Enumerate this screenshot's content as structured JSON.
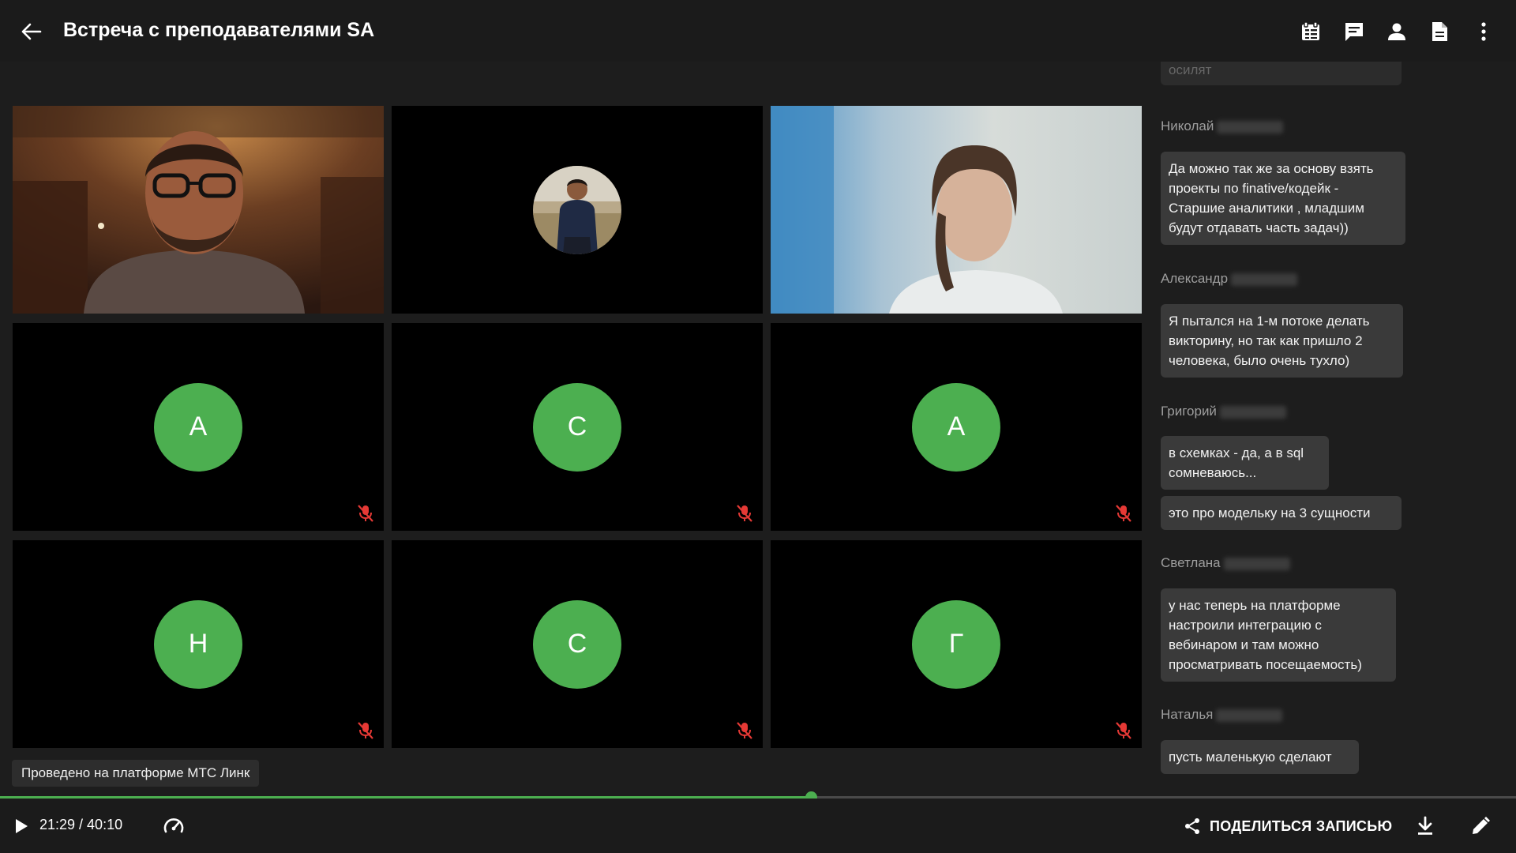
{
  "header": {
    "title": "Встреча с преподавателями SA",
    "icons": [
      "back-arrow-icon",
      "notes-icon",
      "chat-icon",
      "participants-icon",
      "document-icon",
      "more-vertical-icon"
    ]
  },
  "participants": [
    {
      "type": "video",
      "mic_muted": false
    },
    {
      "type": "photo-avatar",
      "mic_muted": false
    },
    {
      "type": "video",
      "mic_muted": false
    },
    {
      "type": "initial",
      "initial": "А",
      "mic_muted": true
    },
    {
      "type": "initial",
      "initial": "С",
      "mic_muted": true
    },
    {
      "type": "initial",
      "initial": "А",
      "mic_muted": true
    },
    {
      "type": "initial",
      "initial": "Н",
      "mic_muted": true
    },
    {
      "type": "initial",
      "initial": "С",
      "mic_muted": true
    },
    {
      "type": "initial",
      "initial": "Г",
      "mic_muted": true
    }
  ],
  "platform_note": "Проведено на платформе МТС Линк",
  "chat": {
    "messages": [
      {
        "text": "осилят"
      },
      {
        "author": "Николай",
        "text": "Да можно так же за основу взять проекты по finative/кодейк - Старшие аналитики , младшим будут отдавать часть задач))"
      },
      {
        "author": "Александр",
        "text": "Я пытался на 1-м потоке делать викторину, но так как пришло 2 человека, было очень тухло)"
      },
      {
        "author": "Григорий",
        "text": "в схемках - да, а в sql сомневаюсь...",
        "text2": "это про модельку на 3 сущности"
      },
      {
        "author": "Светлана",
        "text": "у нас теперь на платформе настроили интеграцию с вебинаром и там можно просматривать посещаемость)"
      },
      {
        "author": "Наталья",
        "text": "пусть маленькую сделают"
      }
    ]
  },
  "player": {
    "time": "21:29 / 40:10",
    "progress": 0.535,
    "share_label": "ПОДЕЛИТЬСЯ ЗАПИСЬЮ",
    "accent": "#4caf50"
  }
}
